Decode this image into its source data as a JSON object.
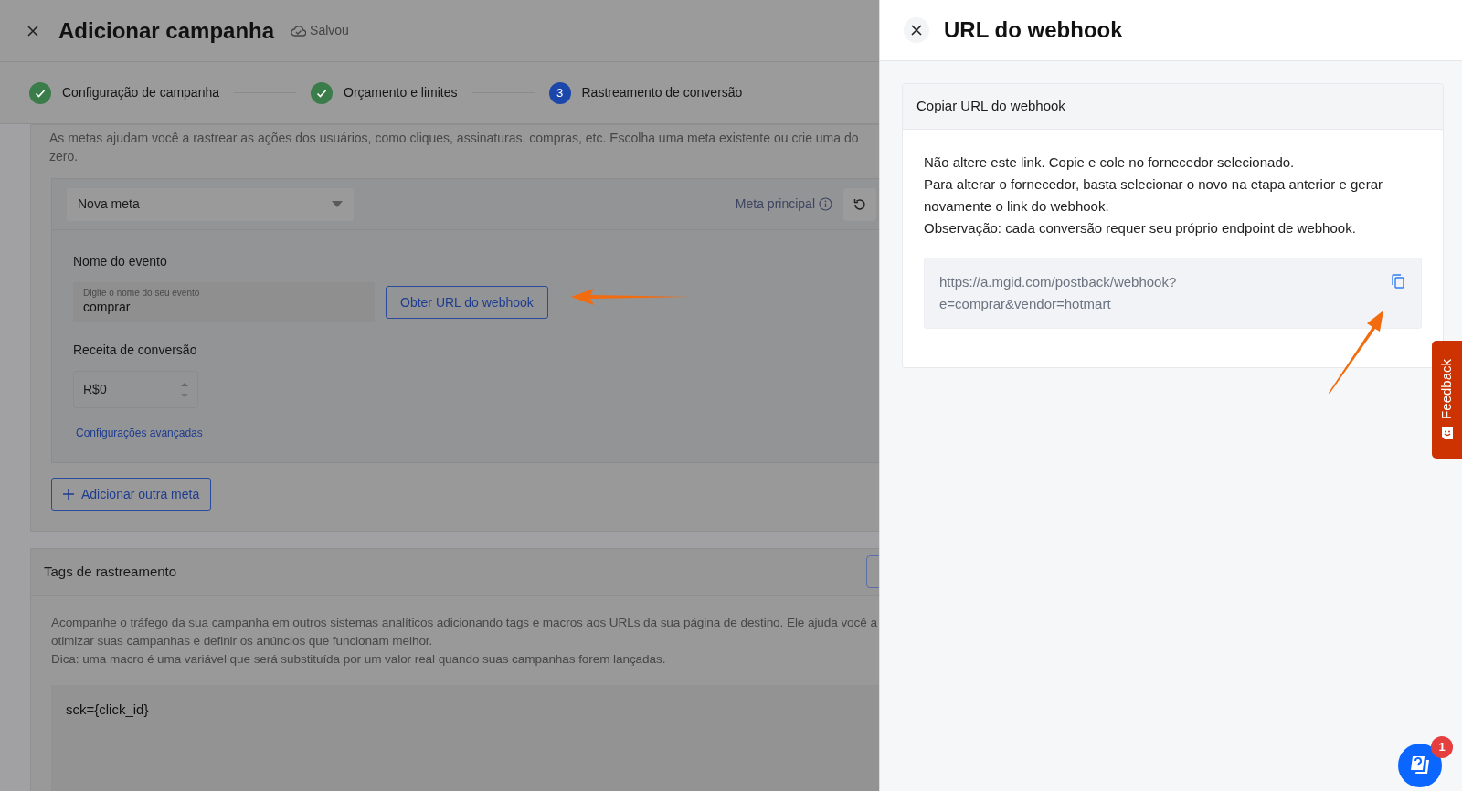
{
  "page": {
    "title": "Adicionar campanha",
    "save_status": "Salvou",
    "steps": [
      {
        "label": "Configuração de campanha",
        "done": true
      },
      {
        "label": "Orçamento e limites",
        "done": true
      },
      {
        "label": "Rastreamento de conversão",
        "done": false,
        "number": "3"
      }
    ],
    "goals": {
      "description": "As metas ajudam você a rastrear as ações dos usuários, como cliques, assinaturas, compras, etc. Escolha uma meta existente ou crie uma do zero.",
      "goal": {
        "select_value": "Nova meta",
        "main_goal_label": "Meta principal",
        "event_label": "Nome do evento",
        "event_placeholder": "Digite o nome do seu evento",
        "event_value": "comprar",
        "webhook_button": "Obter URL do webhook",
        "revenue_label": "Receita de conversão",
        "revenue_value": "R$0",
        "advanced_link": "Configurações avançadas"
      },
      "add_button": "Adicionar outra meta"
    },
    "tracking_tags": {
      "title": "Tags de rastreamento",
      "paragraphs": [
        "Acompanhe o tráfego da sua campanha em outros sistemas analíticos adicionando tags e macros aos URLs da sua página de destino. Ele ajuda você a otimizar suas campanhas e definir os anúncios que funcionam melhor.",
        "Dica: uma macro é uma variável que será substituída por um valor real quando suas campanhas forem lançadas."
      ],
      "tags": [
        {
          "text": "sck={click_id}"
        }
      ]
    }
  },
  "drawer": {
    "title": "URL do webhook",
    "card_title": "Copiar URL do webhook",
    "paragraphs": [
      "Não altere este link. Copie e cole no fornecedor selecionado.",
      "Para alterar o fornecedor, basta selecionar o novo na etapa anterior e gerar novamente o link do webhook.",
      "Observação: cada conversão requer seu próprio endpoint de webhook."
    ],
    "url_lines": [
      "https://a.mgid.com/postback/webhook?",
      "e=comprar&vendor=hotmart"
    ]
  },
  "feedback_tab": "Feedback",
  "help": {
    "badge": "1"
  }
}
